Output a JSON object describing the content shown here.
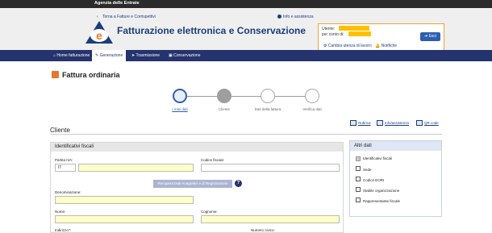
{
  "topbar": {
    "title": "Agenzia delle Entrate"
  },
  "header": {
    "back_link": "Torna a Fatture e Corrispettivi",
    "brand": "Fatturazione elettronica e Conservazione",
    "info_link": "Info e assistenza"
  },
  "user": {
    "line1": "Utente:",
    "line2": "per conto di:",
    "change_env": "Cambia utenza di lavoro",
    "notifications": "Notifiche",
    "exit": "Esci",
    "highlight_color": "#ffc000"
  },
  "nav": {
    "items": [
      {
        "label": "Home fatturazione"
      },
      {
        "label": "Generazione"
      },
      {
        "label": "Trasmissione"
      },
      {
        "label": "Conservazione"
      }
    ]
  },
  "page": {
    "title": "Fattura ordinaria"
  },
  "steps": [
    {
      "label": "I miei dati"
    },
    {
      "label": "Cliente"
    },
    {
      "label": "Dati della fattura"
    },
    {
      "label": "Verifica dati"
    }
  ],
  "section": {
    "title": "Cliente",
    "tools": [
      "Rubrica",
      "Info/assistenza",
      "QR code"
    ]
  },
  "form": {
    "header": "Identificativi fiscali",
    "partita_iva_label": "Partita IVA:",
    "country_value": "IT",
    "codice_fiscale_label": "Codice fiscale:",
    "recover_button": "Recupera Dati Anagrafici e di Registrazione",
    "help": "?",
    "denominazione_label": "Denominazione:",
    "nome_label": "Nome:",
    "cognome_label": "Cognome:",
    "indirizzo_label": "Indirizzo:*",
    "numero_civico_label": "Numero civico:"
  },
  "altri_dati": {
    "header": "Altri dati",
    "items": [
      {
        "label": "Identificativi fiscali",
        "checked": true
      },
      {
        "label": "Sede",
        "checked": false
      },
      {
        "label": "Codice EORI",
        "checked": false
      },
      {
        "label": "Stabile organizzazione",
        "checked": false
      },
      {
        "label": "Rappresentante fiscale",
        "checked": false
      }
    ]
  },
  "colors": {
    "nav_bg": "#25336e",
    "brand_text": "#1a3d7c",
    "required_field": "#ffffc8"
  }
}
